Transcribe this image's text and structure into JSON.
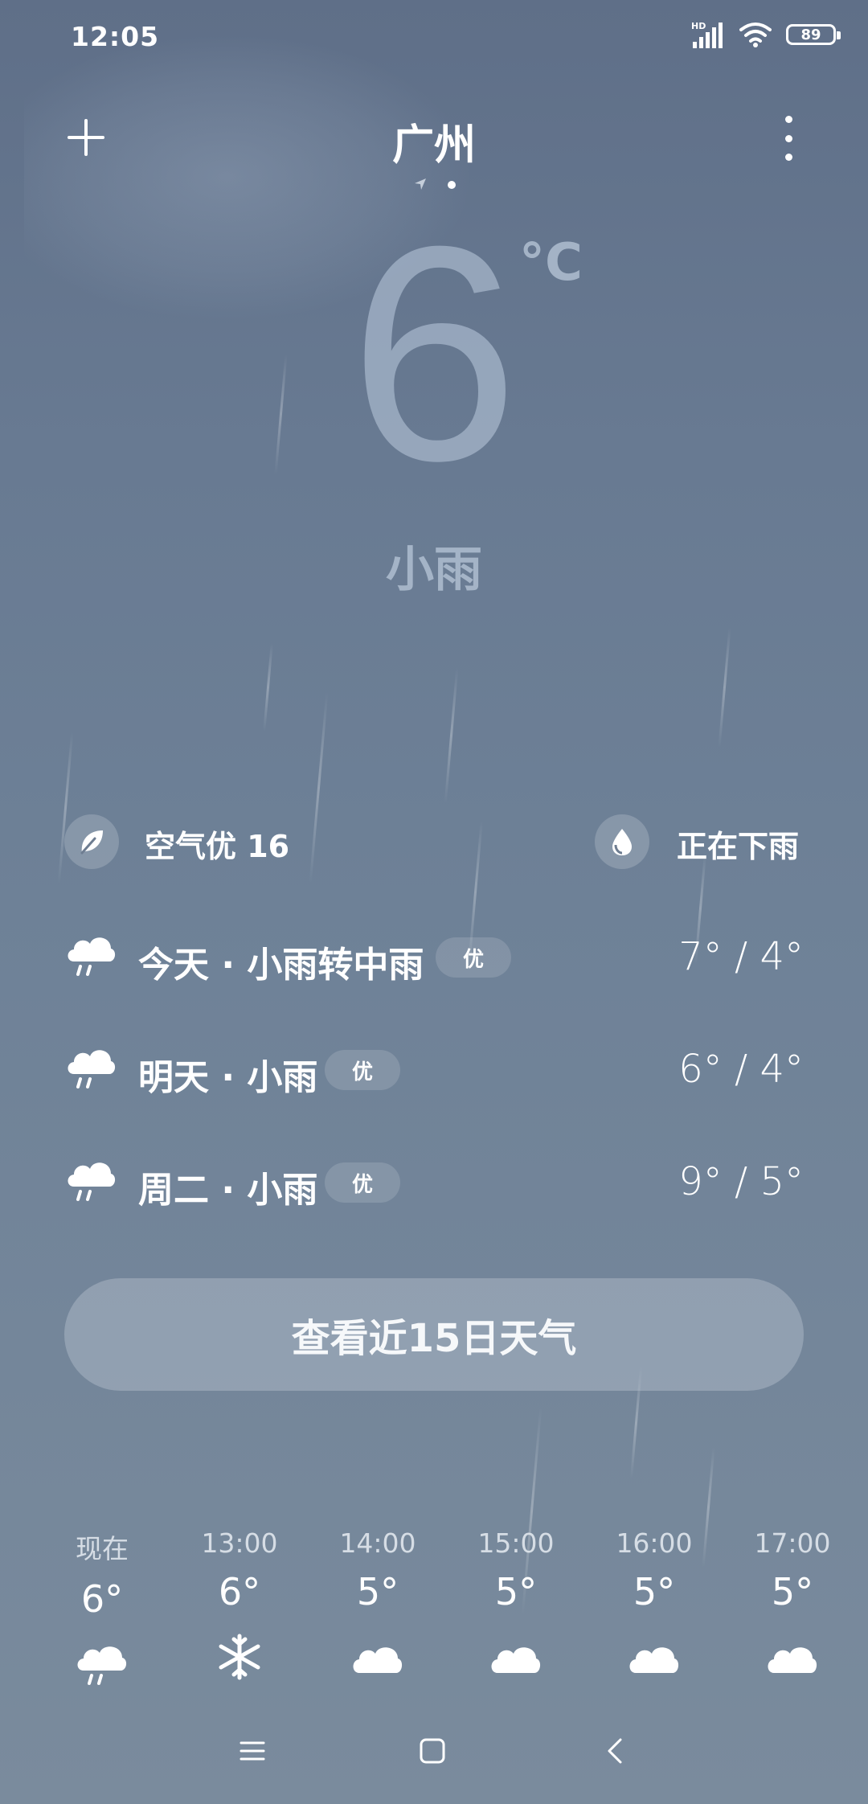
{
  "status_bar": {
    "time": "12:05",
    "network_badge": "HD",
    "battery": "89"
  },
  "header": {
    "city": "广州",
    "add_icon": "plus-icon",
    "more_icon": "more-vertical-icon"
  },
  "current": {
    "temperature": "6",
    "unit": "°C",
    "condition": "小雨"
  },
  "info": {
    "air_quality": "空气优 16",
    "precip_status": "正在下雨",
    "air_icon": "leaf-icon",
    "precip_icon": "droplet-icon"
  },
  "forecast": [
    {
      "label": "今天 · 小雨转中雨",
      "aqi": "优",
      "temp": "7° / 4°",
      "icon": "cloud-rain-icon"
    },
    {
      "label": "明天 · 小雨",
      "aqi": "优",
      "temp": "6° / 4°",
      "icon": "cloud-rain-icon"
    },
    {
      "label": "周二 · 小雨",
      "aqi": "优",
      "temp": "9° / 5°",
      "icon": "cloud-rain-icon"
    }
  ],
  "button_15day": "查看近15日天气",
  "hourly": [
    {
      "time": "现在",
      "temp": "6°",
      "icon": "cloud-rain-icon"
    },
    {
      "time": "13:00",
      "temp": "6°",
      "icon": "snowflake-icon"
    },
    {
      "time": "14:00",
      "temp": "5°",
      "icon": "cloud-icon"
    },
    {
      "time": "15:00",
      "temp": "5°",
      "icon": "cloud-icon"
    },
    {
      "time": "16:00",
      "temp": "5°",
      "icon": "cloud-icon"
    },
    {
      "time": "17:00",
      "temp": "5°",
      "icon": "cloud-icon"
    }
  ]
}
